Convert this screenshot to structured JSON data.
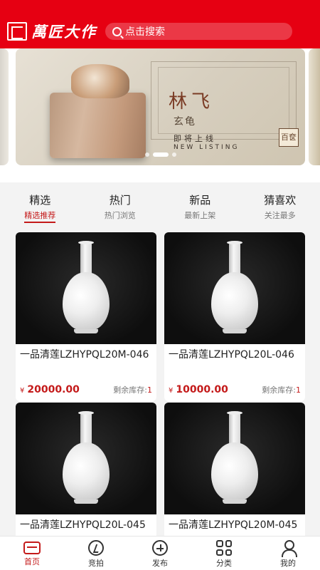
{
  "header": {
    "logo_text": "萬匠大作",
    "search_placeholder": "点击搜索",
    "color": "#e60012"
  },
  "banner": {
    "title": "林飞",
    "subtitle": "玄龟",
    "line1": "即将上线",
    "line2": "NEW LISTING",
    "stamp": "百奁",
    "active_dot": 2,
    "dot_count": 4
  },
  "tabs": [
    {
      "title": "精选",
      "sub": "精选推荐",
      "active": true
    },
    {
      "title": "热门",
      "sub": "热门浏览",
      "active": false
    },
    {
      "title": "新品",
      "sub": "最新上架",
      "active": false
    },
    {
      "title": "猜喜欢",
      "sub": "关注最多",
      "active": false
    }
  ],
  "products": [
    {
      "name": "一品清莲LZHYPQL20M-046",
      "currency": "¥",
      "price": "20000.00",
      "stock_label": "剩余库存:",
      "stock": "1"
    },
    {
      "name": "一品清莲LZHYPQL20L-046",
      "currency": "¥",
      "price": "10000.00",
      "stock_label": "剩余库存:",
      "stock": "1"
    },
    {
      "name": "一品清莲LZHYPQL20L-045",
      "currency": "¥",
      "price": "",
      "stock_label": "",
      "stock": ""
    },
    {
      "name": "一品清莲LZHYPQL20M-045",
      "currency": "¥",
      "price": "",
      "stock_label": "",
      "stock": ""
    }
  ],
  "nav": [
    {
      "label": "首页",
      "icon": "home-icon",
      "active": true
    },
    {
      "label": "竞拍",
      "icon": "auction-icon",
      "active": false
    },
    {
      "label": "发布",
      "icon": "publish-icon",
      "active": false
    },
    {
      "label": "分类",
      "icon": "category-icon",
      "active": false
    },
    {
      "label": "我的",
      "icon": "me-icon",
      "active": false
    }
  ],
  "colors": {
    "accent": "#c41a1a",
    "header": "#e60012"
  }
}
